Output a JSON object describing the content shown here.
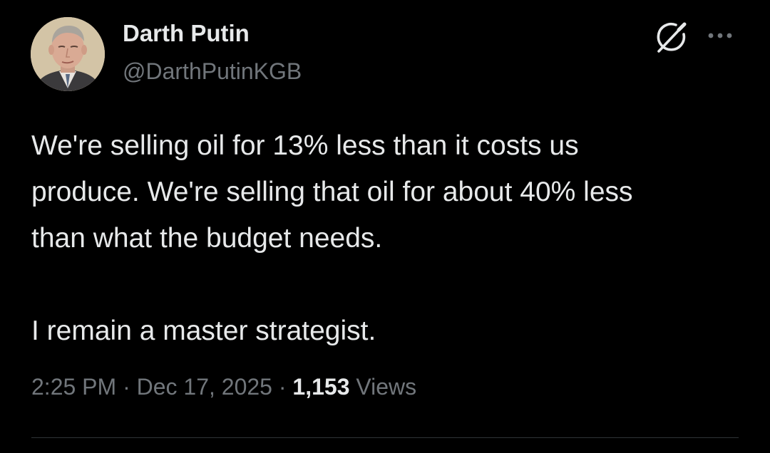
{
  "author": {
    "display_name": "Darth Putin",
    "handle": "@DarthPutinKGB"
  },
  "tweet": {
    "lines": [
      "We're selling oil for 13% less than it costs us",
      "produce. We're selling that oil for about 40% less",
      "than what the budget needs.",
      "I remain a master strategist."
    ]
  },
  "meta": {
    "time": "2:25 PM",
    "separator": "·",
    "date": "Dec 17, 2025",
    "views_count": "1,153",
    "views_label": "Views"
  },
  "icons": {
    "grok": "grok-icon",
    "more": "more-dots-icon"
  },
  "colors": {
    "background": "#000000",
    "primary_text": "#e7e9ea",
    "secondary_text": "#71767b",
    "divider": "#2f3336"
  }
}
